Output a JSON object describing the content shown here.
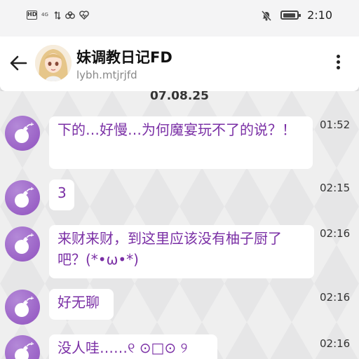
{
  "status_bar": {
    "hd_badge": "HD",
    "signal_text": "4G",
    "time": "2:10",
    "icons": [
      "hd-icon",
      "signal-icon",
      "data-arrows-icon",
      "app-notification-icon",
      "heart-icon",
      "mute-bell-icon",
      "battery-icon"
    ],
    "battery_level": 0.8
  },
  "header": {
    "title": "妹调教日记FD",
    "subtitle": "lybh.mtjrjfd",
    "icons": [
      "back-arrow-icon",
      "avatar-image",
      "more-vertical-icon"
    ]
  },
  "chat": {
    "date": "07.08.25",
    "messages": [
      {
        "text": "下的…好慢…为何魔宴玩不了的说？！",
        "time": "01:52"
      },
      {
        "text": "3",
        "time": "02:15"
      },
      {
        "text": "来财来财，到这里应该没有柚子厨了吧？(*•ω•*)",
        "time": "02:16"
      },
      {
        "text": "好无聊",
        "time": "02:16"
      },
      {
        "text": "没人哇……୧ ⊙□⊙ ୨",
        "time": "02:16"
      }
    ]
  },
  "colors": {
    "accent_purple": "#9052bf",
    "message_text": "#7a2fa5",
    "header_bg": "#ffffff",
    "chat_bg": "#e6e6e7"
  }
}
